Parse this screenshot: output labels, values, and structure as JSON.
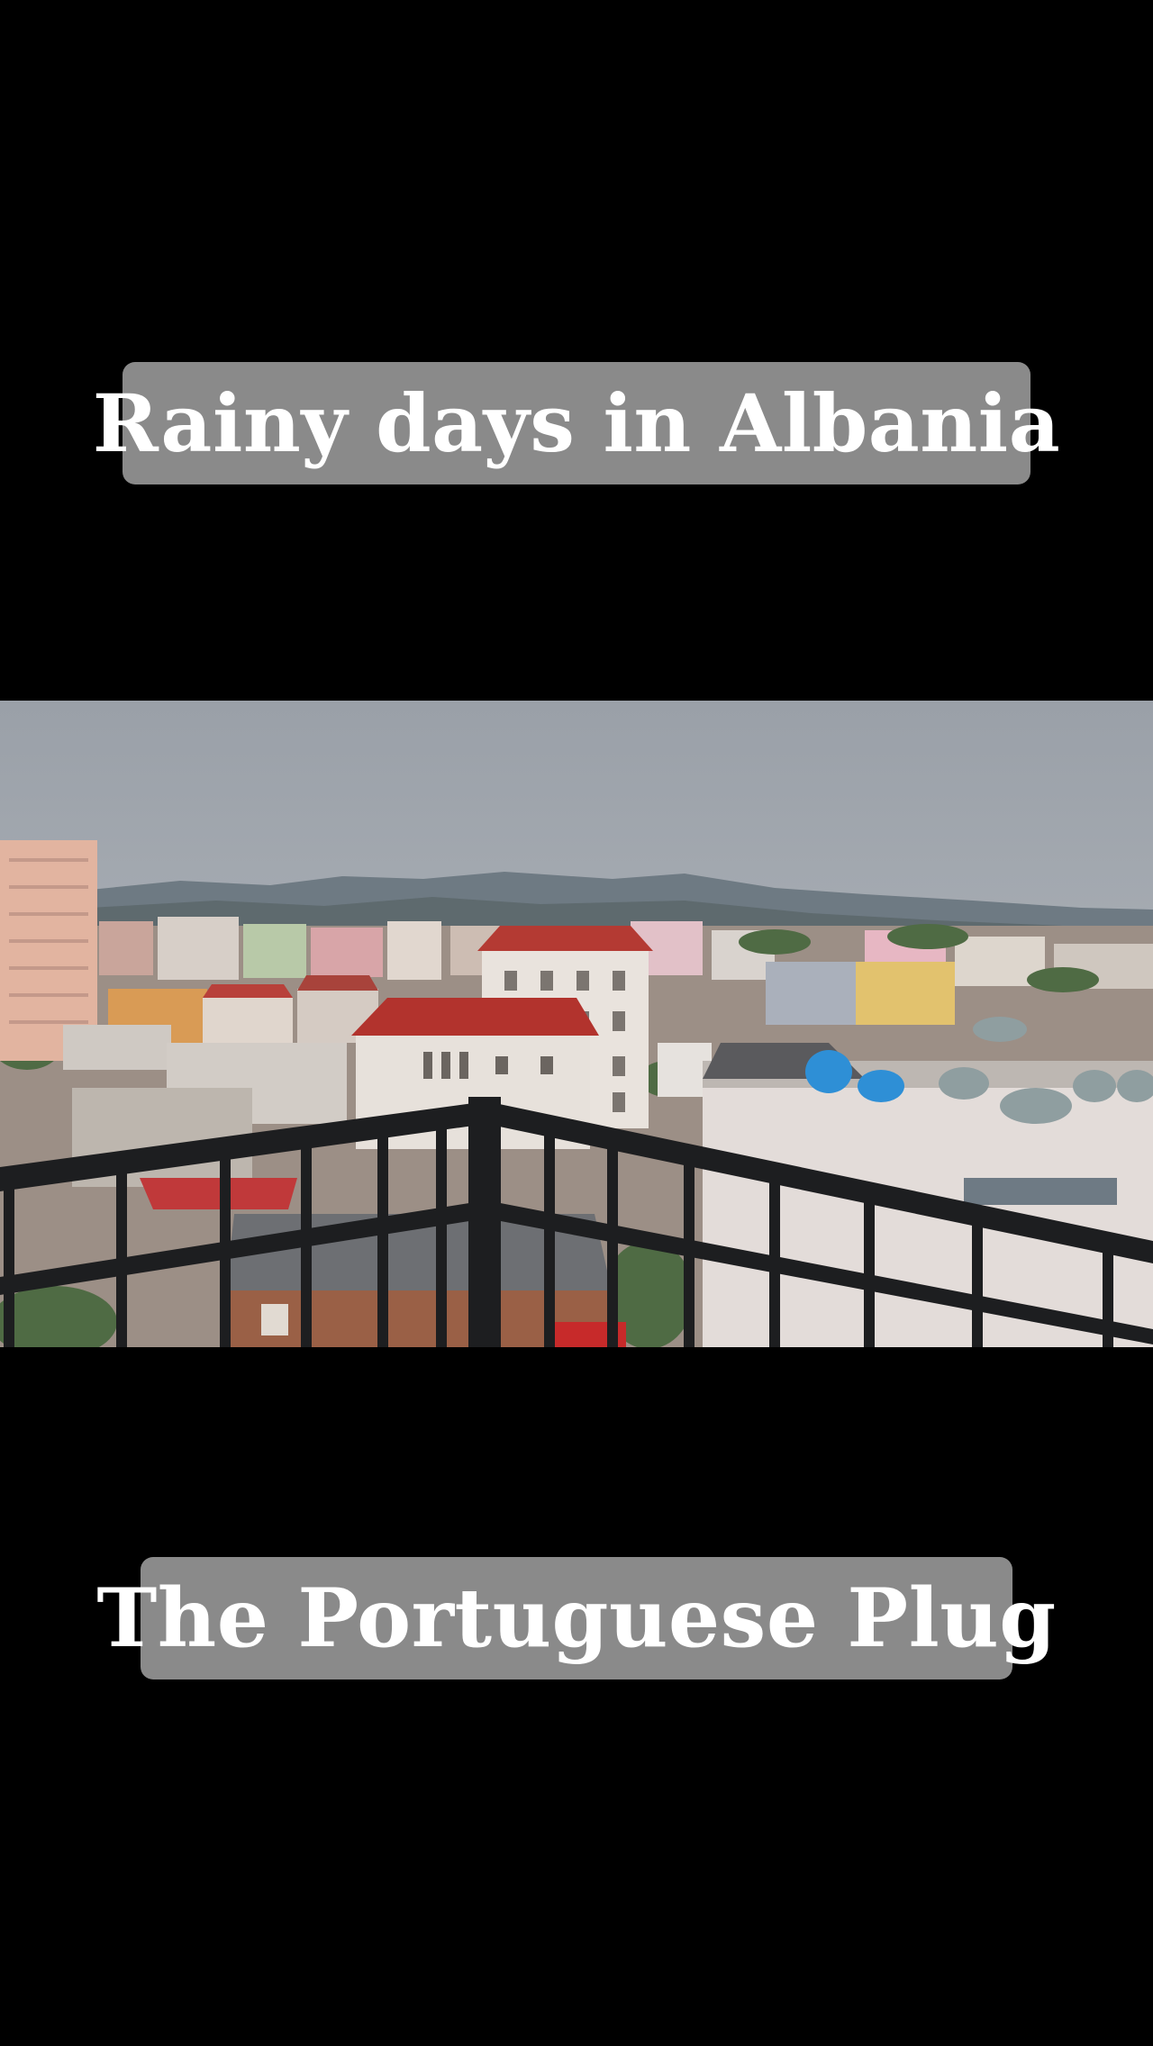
{
  "captions": {
    "top": "Rainy days in Albania",
    "bottom": "The Portuguese Plug"
  },
  "photo": {
    "subject": "view over rooftops of an Albanian town from a balcony on a rainy day"
  },
  "colors": {
    "background": "#000000",
    "caption_bg": "#8a8a8a",
    "caption_text": "#ffffff"
  }
}
